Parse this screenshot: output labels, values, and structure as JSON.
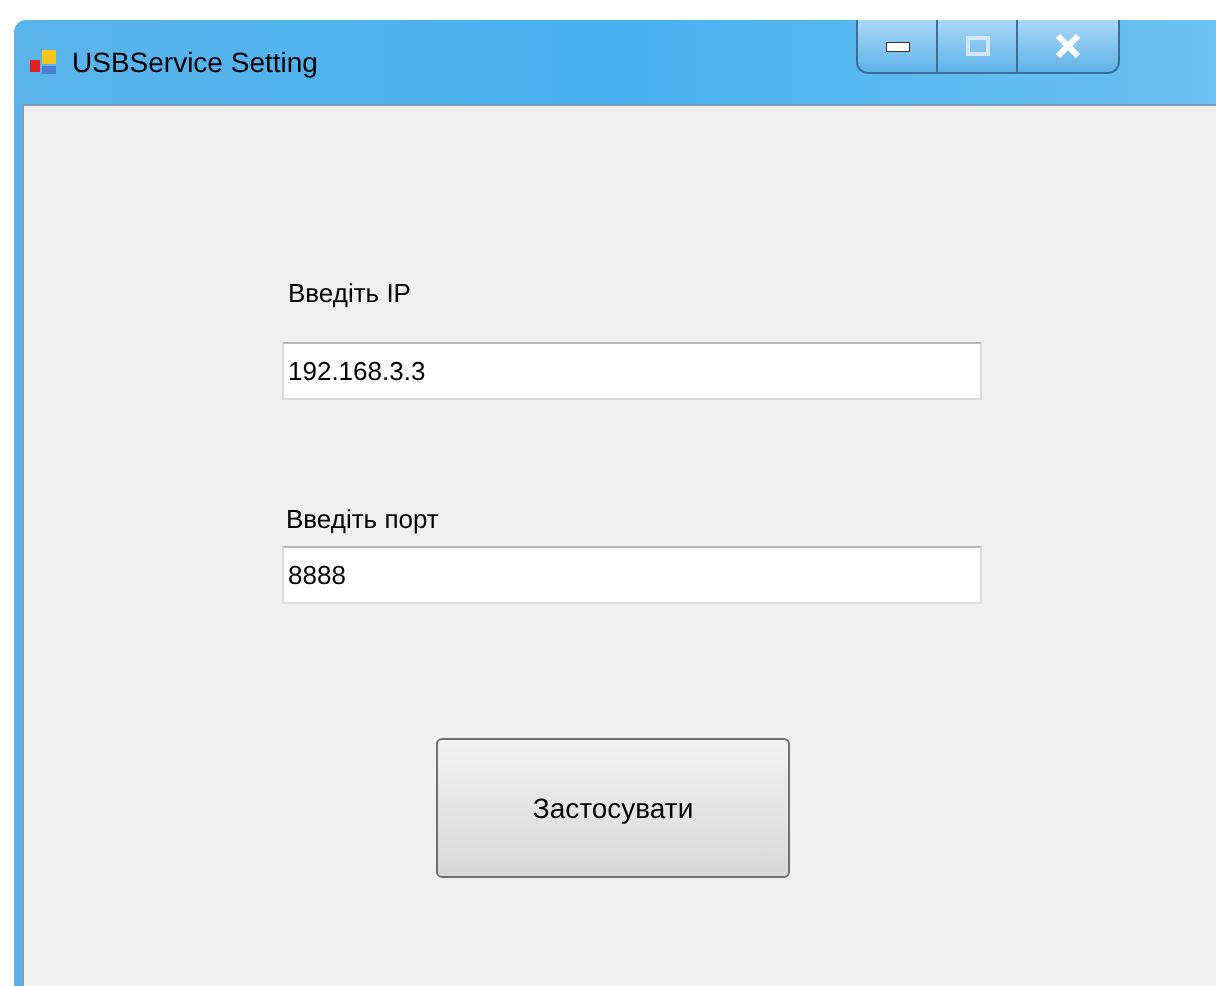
{
  "window": {
    "title": "USBService Setting"
  },
  "fields": [
    {
      "label": "Введіть IP",
      "value": "192.168.3.3"
    },
    {
      "label": "Введіть порт",
      "value": "8888"
    }
  ],
  "button": {
    "label": "Застосувати"
  }
}
